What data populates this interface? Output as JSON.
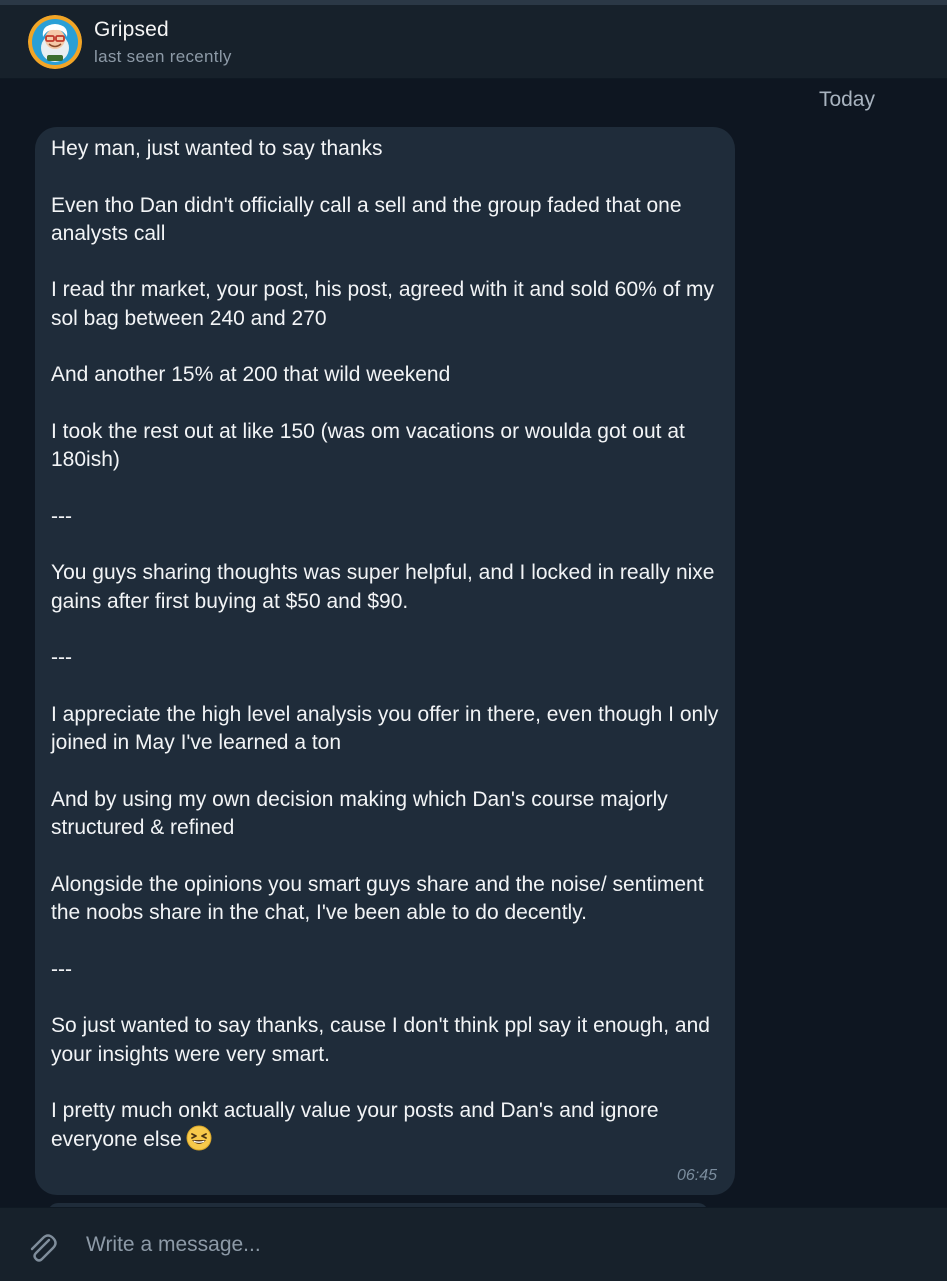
{
  "header": {
    "name": "Gripsed",
    "status": "last seen recently"
  },
  "chat": {
    "date_label": "Today",
    "message": {
      "text": "Hey man, just wanted to say thanks\n\nEven tho Dan didn't officially call a sell and the group faded that one analysts call\n\nI read thr market, your post, his post, agreed with it and sold 60% of my sol bag between 240 and 270\n\nAnd another 15% at 200 that wild weekend\n\nI took the rest out at like 150 (was om vacations or woulda got out at 180ish)\n\n---\n\nYou guys sharing thoughts was super helpful, and I locked in really nixe gains after first buying at $50 and $90.\n\n---\n\nI appreciate the high level analysis you offer in there, even though I only joined in May I've learned a ton\n\nAnd by using my own decision making which Dan's course majorly structured & refined\n\nAlongside the opinions you smart guys share and the noise/ sentiment the noobs share in the chat, I've been able to do decently.\n\n---\n\nSo just wanted to say thanks, cause I don't think ppl say it enough, and your insights were very smart.\n\nI pretty much onkt actually value your posts and Dan's and ignore everyone else",
      "emoji": "grinning-squinting-face-emoji",
      "time": "06:45"
    }
  },
  "composer": {
    "placeholder": "Write a message...",
    "attach_icon": "paperclip-icon"
  },
  "colors": {
    "header_bg": "#17212b",
    "chat_bg": "#0e1621",
    "bubble_bg": "#1f2c3a",
    "secondary_text": "#8d9aa7"
  }
}
